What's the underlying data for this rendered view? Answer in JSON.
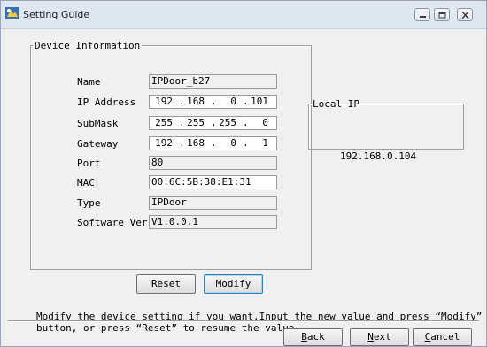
{
  "window": {
    "title": "Setting Guide"
  },
  "device_group": {
    "legend": "Device Information",
    "fields": {
      "name": {
        "label": "Name",
        "value": "IPDoor_b27"
      },
      "ip": {
        "label": "IP Address",
        "octets": [
          "192",
          "168",
          "0",
          "101"
        ]
      },
      "submask": {
        "label": "SubMask",
        "octets": [
          "255",
          "255",
          "255",
          "0"
        ]
      },
      "gateway": {
        "label": "Gateway",
        "octets": [
          "192",
          "168",
          "0",
          "1"
        ]
      },
      "port": {
        "label": "Port",
        "value": "80"
      },
      "mac": {
        "label": "MAC",
        "value": "00:6C:5B:38:E1:31"
      },
      "type": {
        "label": "Type",
        "value": "IPDoor"
      },
      "software": {
        "label": "Software Ver.",
        "value": "V1.0.0.1"
      }
    },
    "buttons": {
      "reset": "Reset",
      "modify": "Modify"
    }
  },
  "local_group": {
    "legend": "Local IP",
    "value": "192.168.0.104"
  },
  "help_text": "Modify the device setting if you want.Input the new value and press “Modify”\nbutton, or press “Reset” to resume the value.",
  "nav": {
    "back": {
      "mnemonic": "B",
      "rest": "ack"
    },
    "next": {
      "mnemonic": "N",
      "rest": "ext"
    },
    "cancel": {
      "mnemonic": "C",
      "rest": "ancel"
    }
  },
  "colors": {
    "titlebar": "#dfe7f1",
    "window_bg": "#f0f0f0",
    "focus_border": "#3c7fb1"
  }
}
